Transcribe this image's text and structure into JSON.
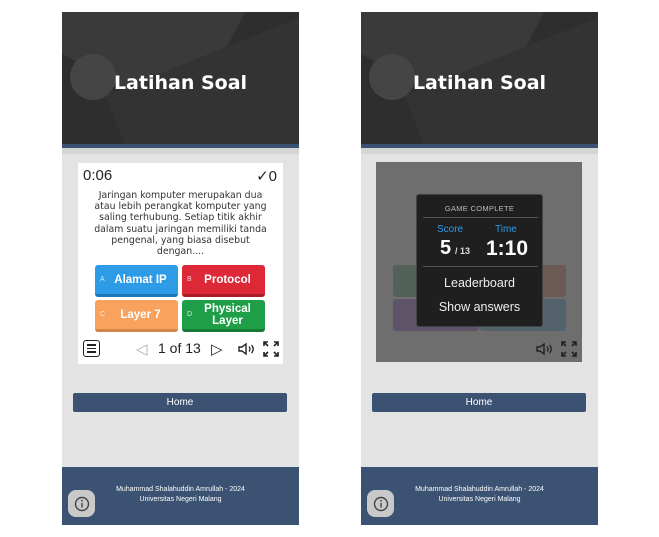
{
  "left": {
    "header_title": "Latihan Soal",
    "timer": "0:06",
    "score": "✓0",
    "question": "Jaringan komputer merupakan dua atau lebih perangkat komputer yang saling terhubung. Setiap titik akhir dalam suatu jaringan memiliki tanda pengenal, yang biasa disebut dengan....",
    "answers": [
      {
        "letter": "A",
        "text": "Alamat IP"
      },
      {
        "letter": "B",
        "text": "Protocol"
      },
      {
        "letter": "C",
        "text": "Layer 7"
      },
      {
        "letter": "D",
        "text": "Physical Layer"
      }
    ],
    "nav_text": "1 of 13",
    "home_label": "Home",
    "footer_line1": "Muhammad Shalahuddin Amrullah - 2024",
    "footer_line2": "Universitas Negeri Malang"
  },
  "right": {
    "header_title": "Latihan Soal",
    "modal_head": "GAME COMPLETE",
    "score_label": "Score",
    "time_label": "Time",
    "score_value": "5",
    "score_total": "/ 13",
    "time_value": "1:10",
    "leaderboard_label": "Leaderboard",
    "show_answers_label": "Show answers",
    "home_label": "Home",
    "footer_line1": "Muhammad Shalahuddin Amrullah - 2024",
    "footer_line2": "Universitas Negeri Malang"
  },
  "colors": {
    "header_bg": "#2e2e2e",
    "accent_blue": "#3b5272",
    "answer_a": "#2d9be6",
    "answer_b": "#dc2837",
    "answer_c": "#f8a25e",
    "answer_d": "#1f9e48"
  }
}
